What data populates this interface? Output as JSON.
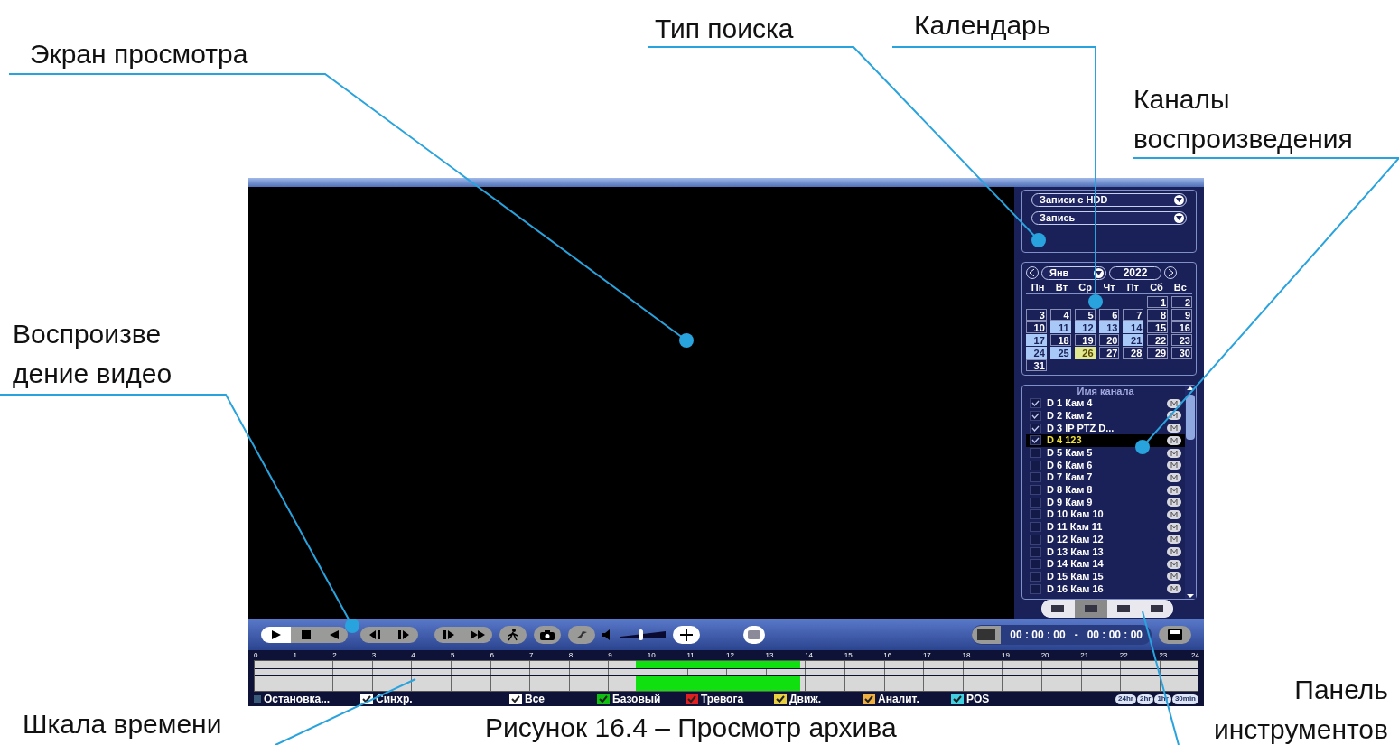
{
  "callouts": [
    {
      "lines": [
        "Экран просмотра"
      ]
    },
    {
      "lines": [
        "Тип поиска"
      ]
    },
    {
      "lines": [
        "Календарь"
      ]
    },
    {
      "lines": [
        "Каналы",
        "воспроизведения"
      ]
    },
    {
      "lines": [
        "Воспроизве",
        "дение видео"
      ]
    },
    {
      "lines": [
        "Шкала времени"
      ]
    },
    {
      "lines": [
        "Панель",
        "инструментов"
      ]
    }
  ],
  "caption": "Рисунок 16.4 – Просмотр архива",
  "search": {
    "source": "Записи с HDD",
    "type": "Запись"
  },
  "calendar": {
    "month": "Янв",
    "year": "2022",
    "weekdays": [
      "Пн",
      "Вт",
      "Ср",
      "Чт",
      "Пт",
      "Сб",
      "Вс"
    ],
    "days": [
      {
        "kind": "blank"
      },
      {
        "kind": "blank"
      },
      {
        "kind": "blank"
      },
      {
        "kind": "blank"
      },
      {
        "kind": "blank"
      },
      {
        "label": "1",
        "kind": "none"
      },
      {
        "label": "2",
        "kind": "none"
      },
      {
        "label": "3",
        "kind": "none"
      },
      {
        "label": "4",
        "kind": "none"
      },
      {
        "label": "5",
        "kind": "none"
      },
      {
        "label": "6",
        "kind": "none"
      },
      {
        "label": "7",
        "kind": "none"
      },
      {
        "label": "8",
        "kind": "none"
      },
      {
        "label": "9",
        "kind": "none"
      },
      {
        "label": "10",
        "kind": "none"
      },
      {
        "label": "11",
        "kind": "record"
      },
      {
        "label": "12",
        "kind": "record"
      },
      {
        "label": "13",
        "kind": "record"
      },
      {
        "label": "14",
        "kind": "record"
      },
      {
        "label": "15",
        "kind": "none"
      },
      {
        "label": "16",
        "kind": "none"
      },
      {
        "label": "17",
        "kind": "record"
      },
      {
        "label": "18",
        "kind": "none"
      },
      {
        "label": "19",
        "kind": "none"
      },
      {
        "label": "20",
        "kind": "none"
      },
      {
        "label": "21",
        "kind": "record"
      },
      {
        "label": "22",
        "kind": "none"
      },
      {
        "label": "23",
        "kind": "none"
      },
      {
        "label": "24",
        "kind": "record"
      },
      {
        "label": "25",
        "kind": "record"
      },
      {
        "label": "26",
        "kind": "selected"
      },
      {
        "label": "27",
        "kind": "none"
      },
      {
        "label": "28",
        "kind": "none"
      },
      {
        "label": "29",
        "kind": "none"
      },
      {
        "label": "30",
        "kind": "none"
      },
      {
        "label": "31",
        "kind": "none"
      }
    ]
  },
  "channels": {
    "header": "Имя канала",
    "items": [
      {
        "name": "D 1 Кам 4",
        "checked": true,
        "selected": false
      },
      {
        "name": "D 2 Кам 2",
        "checked": true,
        "selected": false
      },
      {
        "name": "D 3 IP PTZ D...",
        "checked": true,
        "selected": false
      },
      {
        "name": "D 4 123",
        "checked": true,
        "selected": true
      },
      {
        "name": "D 5 Кам 5",
        "checked": false,
        "selected": false
      },
      {
        "name": "D 6 Кам 6",
        "checked": false,
        "selected": false
      },
      {
        "name": "D 7 Кам 7",
        "checked": false,
        "selected": false
      },
      {
        "name": "D 8 Кам 8",
        "checked": false,
        "selected": false
      },
      {
        "name": "D 9 Кам 9",
        "checked": false,
        "selected": false
      },
      {
        "name": "D 10 Кам 10",
        "checked": false,
        "selected": false
      },
      {
        "name": "D 11 Кам 11",
        "checked": false,
        "selected": false
      },
      {
        "name": "D 12 Кам 12",
        "checked": false,
        "selected": false
      },
      {
        "name": "D 13 Кам 13",
        "checked": false,
        "selected": false
      },
      {
        "name": "D 14 Кам 14",
        "checked": false,
        "selected": false
      },
      {
        "name": "D 15 Кам 15",
        "checked": false,
        "selected": false
      },
      {
        "name": "D 16 Кам 16",
        "checked": false,
        "selected": false
      }
    ]
  },
  "panel_tabs": [
    {
      "selected": false
    },
    {
      "selected": true
    },
    {
      "selected": false
    },
    {
      "selected": false
    }
  ],
  "volume": {
    "level": 0.45
  },
  "time_range": {
    "start": "00 : 00 : 00",
    "separator": "-",
    "end": "00 : 00 : 00"
  },
  "timeline": {
    "hours": [
      "0",
      "1",
      "2",
      "3",
      "4",
      "5",
      "6",
      "7",
      "8",
      "9",
      "10",
      "11",
      "12",
      "13",
      "14",
      "15",
      "16",
      "17",
      "18",
      "19",
      "20",
      "21",
      "22",
      "23",
      "24"
    ],
    "rows": [
      {
        "recorded": true
      },
      {
        "recorded": false
      },
      {
        "recorded": true
      },
      {
        "recorded": true
      }
    ]
  },
  "legend": [
    {
      "label": "Остановка...",
      "kind": "status",
      "color": "#3a5a7a"
    },
    {
      "label": "Синхр.",
      "kind": "checkbox",
      "color": "#ffffff",
      "checked": true
    },
    {
      "label": "Все",
      "kind": "checkbox",
      "color": "#ffffff",
      "checked": true
    },
    {
      "label": "Базовый",
      "kind": "checkbox",
      "color": "#10c010",
      "checked": true
    },
    {
      "label": "Тревога",
      "kind": "checkbox",
      "color": "#e02020",
      "checked": true
    },
    {
      "label": "Движ.",
      "kind": "checkbox",
      "color": "#e8d040",
      "checked": true
    },
    {
      "label": "Аналит.",
      "kind": "checkbox",
      "color": "#f0b040",
      "checked": true
    },
    {
      "label": "POS",
      "kind": "checkbox",
      "color": "#40d0e0",
      "checked": true
    }
  ],
  "zoom_buttons": [
    "24hr",
    "2hr",
    "1hr",
    "30min"
  ]
}
